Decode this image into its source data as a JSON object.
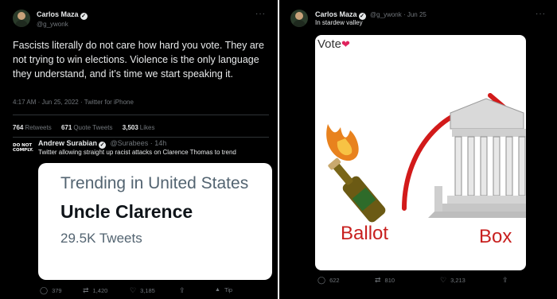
{
  "colors": {
    "background": "#000000",
    "text": "#e7e9ea",
    "muted": "#71767b",
    "divider": "#2f3336",
    "ballot_red": "#c8201f",
    "heart": "#e0245e"
  },
  "left": {
    "author": {
      "name": "Carlos Maza",
      "handle": "@g_ywonk"
    },
    "more_icon": "more-horizontal-icon",
    "text": "Fascists literally do not care how hard you vote. They are not trying to win elections. Violence is the only language they understand, and it’s time we start speaking it.",
    "meta": "4:17 AM · Jun 25, 2022 · Twitter for iPhone",
    "stats": [
      {
        "count": "764",
        "label": "Retweets"
      },
      {
        "count": "671",
        "label": "Quote Tweets"
      },
      {
        "count": "3,503",
        "label": "Likes"
      }
    ],
    "quoted": {
      "avatar_text_line1": "DO NOT",
      "avatar_text_line2": "COMPLY.",
      "name": "Andrew Surabian",
      "handle_time": "@Surabees · 14h",
      "text": "Twitter allowing straight up racist attacks on Clarence Thomas to trend",
      "card": {
        "line1": "Trending in United States",
        "line2": "Uncle Clarence",
        "line3": "29.5K Tweets"
      },
      "actions": [
        {
          "icon": "reply-icon",
          "glyph": "◯",
          "count": "379"
        },
        {
          "icon": "retweet-icon",
          "glyph": "⇄",
          "count": "1,420"
        },
        {
          "icon": "like-icon",
          "glyph": "♡",
          "count": "3,185"
        },
        {
          "icon": "share-icon",
          "glyph": "⇪",
          "count": ""
        },
        {
          "icon": "tip-icon",
          "glyph": "▲",
          "count": "Tip"
        }
      ]
    }
  },
  "right": {
    "author": {
      "name": "Carlos Maza",
      "handle_time": "@g_ywonk · Jun 25"
    },
    "more_icon": "more-horizontal-icon",
    "text": "In stardew valley",
    "meme": {
      "top_label": "Vote",
      "heart": "❤",
      "left_label": "Ballot",
      "right_label": "Box"
    },
    "actions": [
      {
        "icon": "reply-icon",
        "glyph": "◯",
        "count": "622"
      },
      {
        "icon": "retweet-icon",
        "glyph": "⇄",
        "count": "810"
      },
      {
        "icon": "like-icon",
        "glyph": "♡",
        "count": "3,213"
      },
      {
        "icon": "share-icon",
        "glyph": "⇪",
        "count": ""
      }
    ]
  }
}
